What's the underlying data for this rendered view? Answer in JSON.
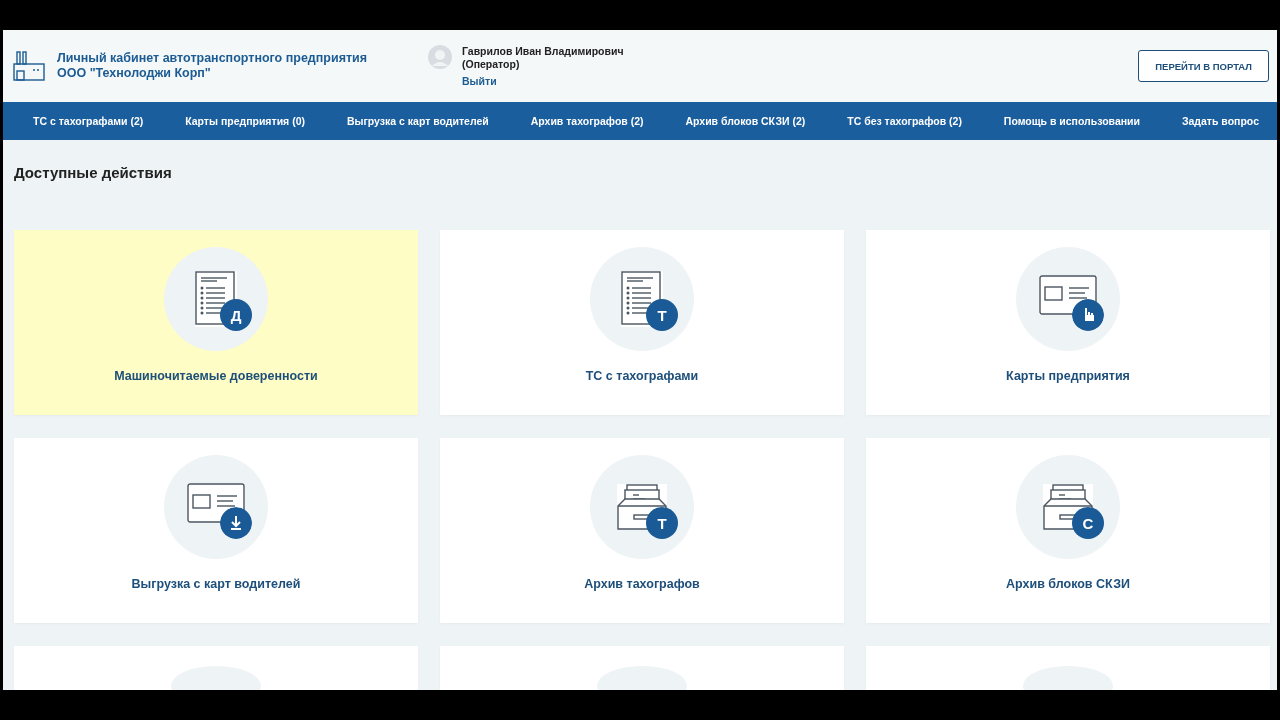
{
  "header": {
    "title_line1": "Личный кабинет автотранспортного предприятия",
    "title_line2": "ООО \"Технолоджи Корп\"",
    "user_name": "Гаврилов Иван Владимирович",
    "user_role": "(Оператор)",
    "logout": "Выйти",
    "portal_button": "ПЕРЕЙТИ В ПОРТАЛ"
  },
  "nav": [
    "ТС с тахографами (2)",
    "Карты предприятия (0)",
    "Выгрузка с карт водителей",
    "Архив тахографов (2)",
    "Архив блоков СКЗИ (2)",
    "ТС без тахографов (2)",
    "Помощь в использовании",
    "Задать вопрос"
  ],
  "section_title": "Доступные действия",
  "cards": [
    {
      "label": "Машиночитаемые доверенности",
      "kind": "document",
      "badge": "Д",
      "highlighted": true
    },
    {
      "label": "ТС с тахографами",
      "kind": "document",
      "badge": "Т",
      "highlighted": false
    },
    {
      "label": "Карты предприятия",
      "kind": "cardpointer",
      "highlighted": false
    },
    {
      "label": "Выгрузка с карт водителей",
      "kind": "carddownload",
      "highlighted": false
    },
    {
      "label": "Архив тахографов",
      "kind": "tray",
      "badge": "Т",
      "highlighted": false
    },
    {
      "label": "Архив блоков СКЗИ",
      "kind": "tray",
      "badge": "С",
      "highlighted": false
    }
  ]
}
